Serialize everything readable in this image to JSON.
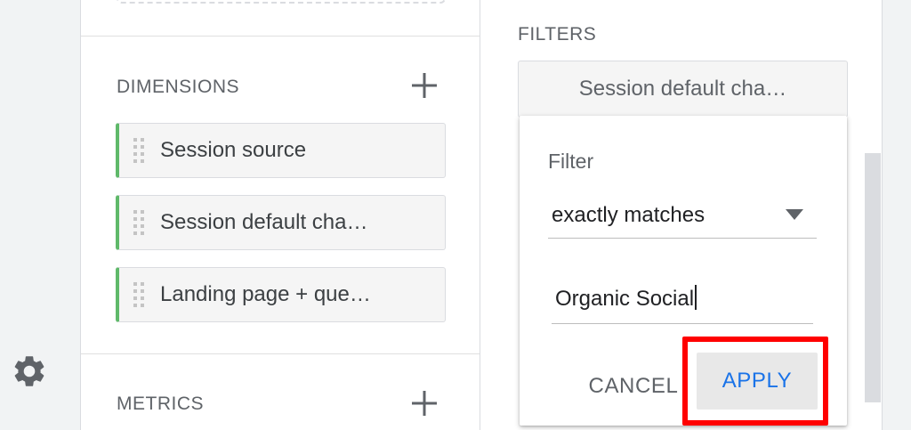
{
  "sidebar": {
    "settings_icon": "gear-icon"
  },
  "variables_panel": {
    "dimensions": {
      "title": "DIMENSIONS",
      "add_icon": "plus-icon",
      "items": [
        {
          "label": "Session source"
        },
        {
          "label": "Session default cha…"
        },
        {
          "label": "Landing page + que…"
        }
      ]
    },
    "metrics": {
      "title": "METRICS",
      "add_icon": "plus-icon"
    }
  },
  "settings_panel": {
    "filters": {
      "title": "FILTERS",
      "chip_label": "Session default cha…"
    }
  },
  "filter_popup": {
    "label": "Filter",
    "match_type": "exactly matches",
    "value": "Organic Social",
    "cancel_label": "CANCEL",
    "apply_label": "APPLY"
  },
  "colors": {
    "accent_blue": "#1a73e8",
    "dimension_chip_border": "#5fb96a",
    "highlight_red": "#ff0000"
  }
}
